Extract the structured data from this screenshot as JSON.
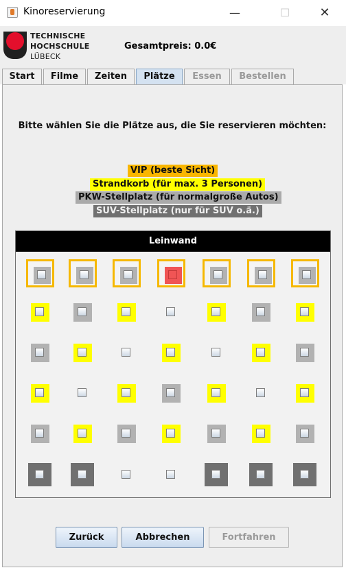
{
  "window": {
    "title": "Kinoreservierung",
    "minimize_glyph": "—",
    "maximize_glyph": "☐",
    "close_glyph": "✕"
  },
  "logo": {
    "line1": "TECHNISCHE",
    "line2": "HOCHSCHULE",
    "line3": "LÜBECK"
  },
  "header": {
    "total_price": "Gesamtpreis: 0.0€"
  },
  "tabs": [
    {
      "label": "Start",
      "state": "normal"
    },
    {
      "label": "Filme",
      "state": "normal"
    },
    {
      "label": "Zeiten",
      "state": "normal"
    },
    {
      "label": "Plätze",
      "state": "active"
    },
    {
      "label": "Essen",
      "state": "disabled"
    },
    {
      "label": "Bestellen",
      "state": "disabled"
    }
  ],
  "instruction": "Bitte wählen Sie die Plätze aus, die Sie reservieren möchten:",
  "legend": {
    "vip": "VIP (beste Sicht)",
    "strandkorb": "Strandkorb (für max. 3 Personen)",
    "pkw": "PKW-Stellplatz (für normalgroße Autos)",
    "suv": "SUV-Stellplatz (nur für SUV o.ä.)"
  },
  "colors": {
    "vip": "#f9b600",
    "strandkorb": "#ffff00",
    "pkw": "#aaaaaa",
    "suv": "#707070",
    "taken": "#f05555"
  },
  "screen_label": "Leinwand",
  "seat_rows": [
    [
      "vip-gray",
      "vip-gray",
      "vip-gray",
      "vip-taken",
      "vip-gray",
      "vip-gray",
      "vip-gray"
    ],
    [
      "yellow",
      "gray",
      "yellow",
      "taken",
      "yellow",
      "gray",
      "yellow"
    ],
    [
      "gray",
      "yellow",
      "taken",
      "yellow",
      "taken",
      "yellow",
      "gray"
    ],
    [
      "yellow",
      "taken",
      "yellow",
      "gray",
      "yellow",
      "taken",
      "yellow"
    ],
    [
      "gray",
      "yellow",
      "gray",
      "yellow",
      "gray",
      "yellow",
      "gray"
    ],
    [
      "dark",
      "dark",
      "taken",
      "taken",
      "dark",
      "dark",
      "dark"
    ]
  ],
  "buttons": {
    "back": "Zurück",
    "cancel": "Abbrechen",
    "next": "Fortfahren"
  }
}
